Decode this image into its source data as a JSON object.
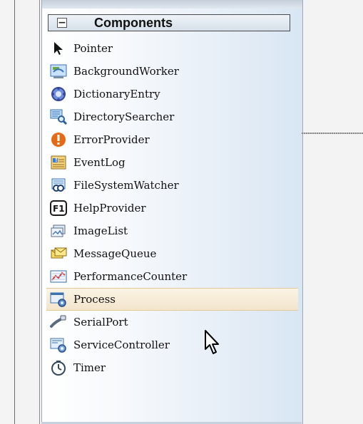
{
  "toolbox": {
    "group_title": "Components",
    "collapse_symbol": "⊟",
    "items": [
      {
        "label": "Pointer",
        "icon": "pointer-icon"
      },
      {
        "label": "BackgroundWorker",
        "icon": "background-worker-icon"
      },
      {
        "label": "DictionaryEntry",
        "icon": "dictionary-entry-icon"
      },
      {
        "label": "DirectorySearcher",
        "icon": "directory-searcher-icon"
      },
      {
        "label": "ErrorProvider",
        "icon": "error-provider-icon"
      },
      {
        "label": "EventLog",
        "icon": "event-log-icon"
      },
      {
        "label": "FileSystemWatcher",
        "icon": "file-system-watcher-icon"
      },
      {
        "label": "HelpProvider",
        "icon": "help-provider-icon"
      },
      {
        "label": "ImageList",
        "icon": "image-list-icon"
      },
      {
        "label": "MessageQueue",
        "icon": "message-queue-icon"
      },
      {
        "label": "PerformanceCounter",
        "icon": "performance-counter-icon"
      },
      {
        "label": "Process",
        "icon": "process-icon"
      },
      {
        "label": "SerialPort",
        "icon": "serial-port-icon"
      },
      {
        "label": "ServiceController",
        "icon": "service-controller-icon"
      },
      {
        "label": "Timer",
        "icon": "timer-icon"
      }
    ],
    "selected_item": "Process",
    "help_provider_icon_text": "F1"
  }
}
